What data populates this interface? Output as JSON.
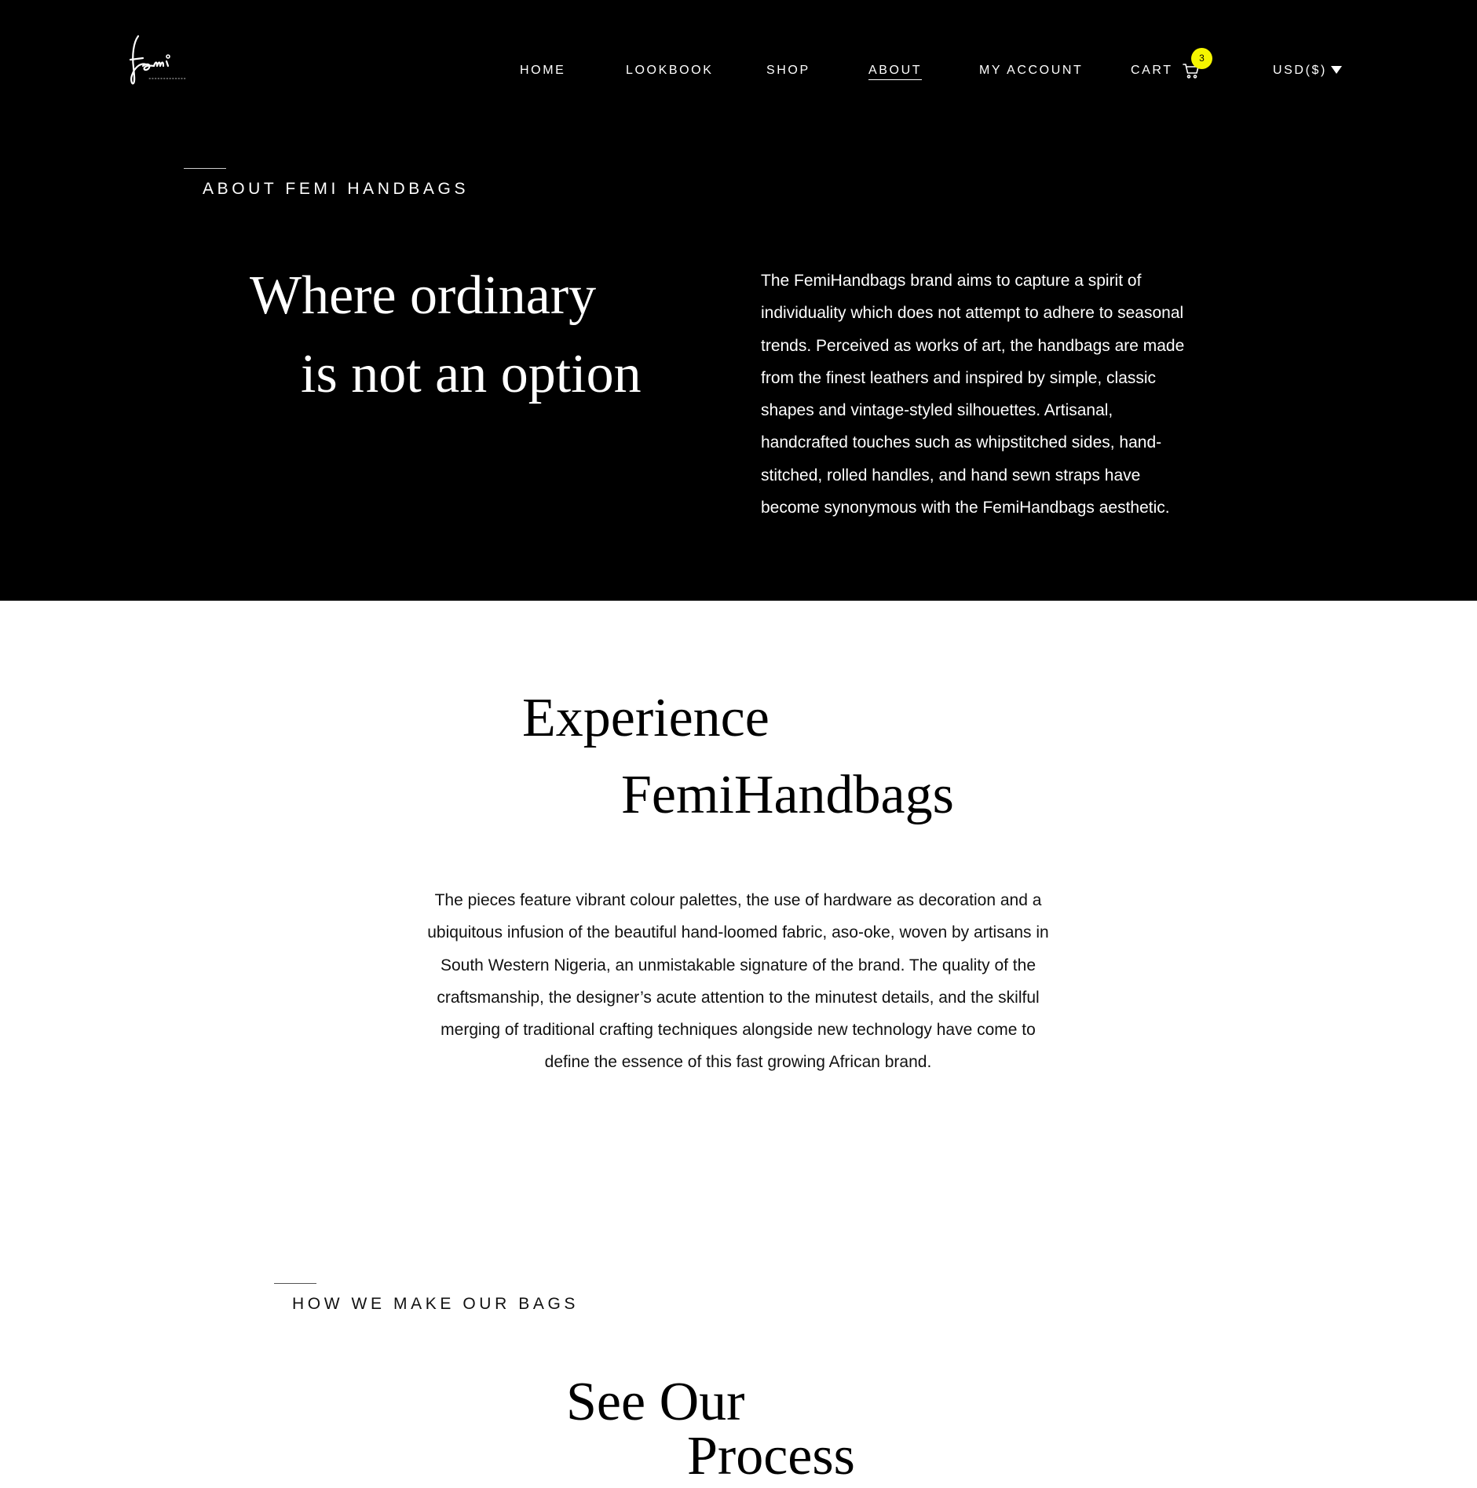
{
  "header": {
    "logo_alt": "femi handbags",
    "nav": [
      {
        "label": "HOME",
        "active": false
      },
      {
        "label": "LOOKBOOK",
        "active": false
      },
      {
        "label": "SHOP",
        "active": false
      },
      {
        "label": "ABOUT",
        "active": true
      },
      {
        "label": "MY ACCOUNT",
        "active": false
      },
      {
        "label": "CART",
        "active": false
      }
    ],
    "cart_count": "3",
    "currency": "USD($)"
  },
  "about": {
    "eyebrow": "ABOUT FEMI HANDBAGS",
    "heading_line1": "Where ordinary",
    "heading_line2": "is not an option",
    "body_lines": [
      "The FemiHandbags brand aims to capture a spirit of",
      "individuality which does not attempt to adhere to seasonal",
      "trends. Perceived as works of art, the handbags are made",
      "from the finest leathers and inspired by simple, classic",
      "shapes and vintage-styled silhouettes.  Artisanal,",
      "handcrafted touches such as whipstitched sides, hand-",
      "stitched, rolled handles, and hand sewn straps have",
      "become synonymous with the FemiHandbags aesthetic."
    ]
  },
  "experience": {
    "heading_line1": "Experience",
    "heading_line2": "FemiHandbags",
    "body_lines": [
      "The pieces feature vibrant colour palettes, the use of hardware as decoration  and a",
      "ubiquitous infusion of the beautiful hand-loomed fabric, aso-oke, woven by artisans in",
      "South Western Nigeria, an unmistakable signature of the brand. The quality of the",
      "craftsmanship, the designer’s acute attention to the minutest details, and the skilful",
      "merging of traditional crafting techniques alongside new technology have come to",
      "define the essence of this fast growing African brand."
    ]
  },
  "process": {
    "eyebrow": "HOW WE MAKE OUR BAGS",
    "heading_line1": "See Our",
    "heading_line2": "Process"
  },
  "colors": {
    "hero_bg": "#000000",
    "page_bg": "#ffffff",
    "badge": "#f5f500"
  },
  "icons": {
    "cart": "cart-icon",
    "currency_caret": "caret-down-icon",
    "logo": "femi-logo-icon"
  }
}
